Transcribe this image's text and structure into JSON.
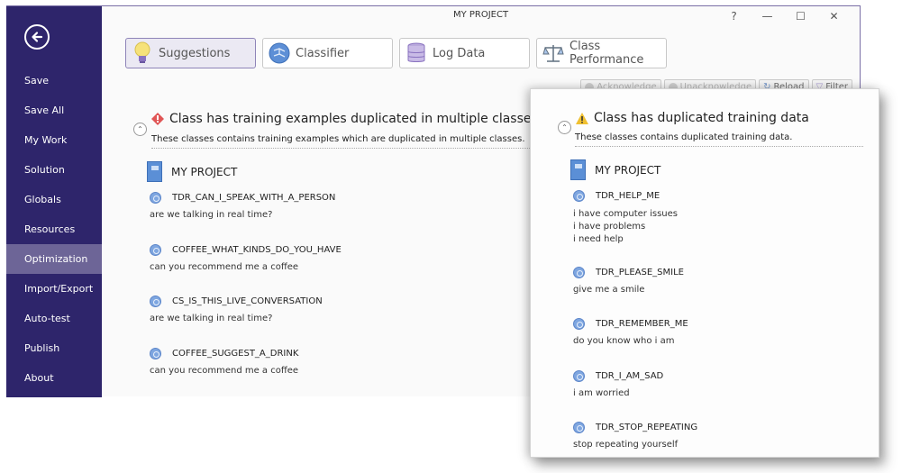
{
  "window": {
    "title": "MY PROJECT",
    "controls": {
      "help": "?",
      "minimize": "—",
      "maximize": "☐",
      "close": "✕"
    }
  },
  "sidebar": {
    "back_icon": "back-arrow-icon",
    "items": [
      {
        "label": "Save",
        "active": false
      },
      {
        "label": "Save All",
        "active": false
      },
      {
        "label": "My Work",
        "active": false
      },
      {
        "label": "Solution",
        "active": false
      },
      {
        "label": "Globals",
        "active": false
      },
      {
        "label": "Resources",
        "active": false
      },
      {
        "label": "Optimization",
        "active": true
      },
      {
        "label": "Import/Export",
        "active": false
      },
      {
        "label": "Auto-test",
        "active": false
      },
      {
        "label": "Publish",
        "active": false
      },
      {
        "label": "About",
        "active": false
      }
    ]
  },
  "tabs": [
    {
      "label": "Suggestions",
      "icon": "lightbulb-icon",
      "active": true
    },
    {
      "label": "Classifier",
      "icon": "network-icon",
      "active": false
    },
    {
      "label": "Log Data",
      "icon": "database-icon",
      "active": false
    },
    {
      "label": "Class Performance",
      "icon": "scales-icon",
      "active": false
    }
  ],
  "toolbar": {
    "acknowledge": "Acknowledge",
    "unacknowledge": "Unacknowledge",
    "reload": "Reload",
    "filter": "Filter"
  },
  "main_section": {
    "title": "Class has training examples duplicated in multiple classes",
    "severity": "error",
    "description": "These classes contains training examples which are duplicated in multiple classes.",
    "project": "MY PROJECT",
    "classes": [
      {
        "name": "TDR_CAN_I_SPEAK_WITH_A_PERSON",
        "examples": [
          "are we talking in real time?"
        ]
      },
      {
        "name": "COFFEE_WHAT_KINDS_DO_YOU_HAVE",
        "examples": [
          "can you recommend me a coffee"
        ]
      },
      {
        "name": "CS_IS_THIS_LIVE_CONVERSATION",
        "examples": [
          "are we talking in real time?"
        ]
      },
      {
        "name": "COFFEE_SUGGEST_A_DRINK",
        "examples": [
          "can you recommend me a coffee"
        ]
      }
    ]
  },
  "popup_section": {
    "title": "Class has duplicated training data",
    "severity": "warning",
    "description": "These classes contains duplicated training data.",
    "project": "MY PROJECT",
    "classes": [
      {
        "name": "TDR_HELP_ME",
        "examples": [
          "i have computer issues",
          "i have problems",
          "i need help"
        ]
      },
      {
        "name": "TDR_PLEASE_SMILE",
        "examples": [
          "give me a smile"
        ]
      },
      {
        "name": "TDR_REMEMBER_ME",
        "examples": [
          "do you know who i am"
        ]
      },
      {
        "name": "TDR_I_AM_SAD",
        "examples": [
          "i am worried"
        ]
      },
      {
        "name": "TDR_STOP_REPEATING",
        "examples": [
          "stop repeating yourself"
        ]
      }
    ]
  },
  "colors": {
    "sidebar_bg": "#2e256b",
    "sidebar_active": "#6d6597",
    "accent": "#8e84b8",
    "error": "#e05555",
    "warning": "#f0c030"
  }
}
